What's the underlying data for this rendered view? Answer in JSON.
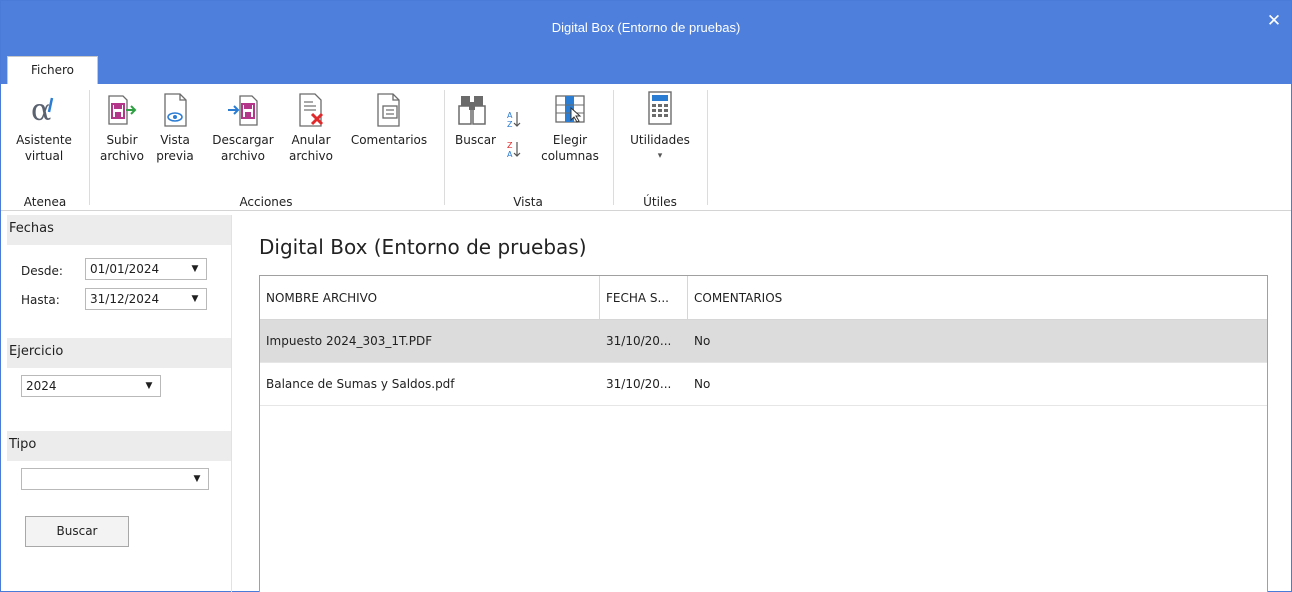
{
  "window": {
    "title": "Digital Box (Entorno de pruebas)",
    "close_glyph": "✕"
  },
  "ribbon": {
    "tab": "Fichero",
    "groups": {
      "atenea": {
        "label": "Atenea",
        "asistente_l1": "Asistente",
        "asistente_l2": "virtual"
      },
      "acciones": {
        "label": "Acciones",
        "subir_l1": "Subir",
        "subir_l2": "archivo",
        "vista_l1": "Vista",
        "vista_l2": "previa",
        "descargar_l1": "Descargar",
        "descargar_l2": "archivo",
        "anular_l1": "Anular",
        "anular_l2": "archivo",
        "comentarios": "Comentarios"
      },
      "vista": {
        "label": "Vista",
        "buscar": "Buscar",
        "elegir_l1": "Elegir",
        "elegir_l2": "columnas"
      },
      "utiles": {
        "label": "Útiles",
        "utilidades": "Utilidades",
        "dropdown_glyph": "▾"
      }
    }
  },
  "filters": {
    "fechas": {
      "header": "Fechas",
      "desde_label": "Desde:",
      "desde_value": "01/01/2024",
      "hasta_label": "Hasta:",
      "hasta_value": "31/12/2024"
    },
    "ejercicio": {
      "header": "Ejercicio",
      "value": "2024"
    },
    "tipo": {
      "header": "Tipo",
      "value": ""
    },
    "buscar_button": "Buscar",
    "arrow": "▼"
  },
  "main": {
    "title": "Digital Box (Entorno de pruebas)",
    "columns": [
      "NOMBRE ARCHIVO",
      "FECHA S...",
      "COMENTARIOS"
    ],
    "rows": [
      {
        "nombre": "Impuesto 2024_303_1T.PDF",
        "fecha": "31/10/20...",
        "comentarios": "No",
        "selected": true
      },
      {
        "nombre": "Balance de Sumas y Saldos.pdf",
        "fecha": "31/10/20...",
        "comentarios": "No",
        "selected": false
      }
    ]
  },
  "colors": {
    "titlebar": "#4e7fdc",
    "selected_row": "#dcdcdc",
    "accent_green": "#2ea043",
    "accent_red": "#e0292b",
    "accent_blue": "#2b7cd3",
    "icon_magenta": "#b4368b"
  }
}
